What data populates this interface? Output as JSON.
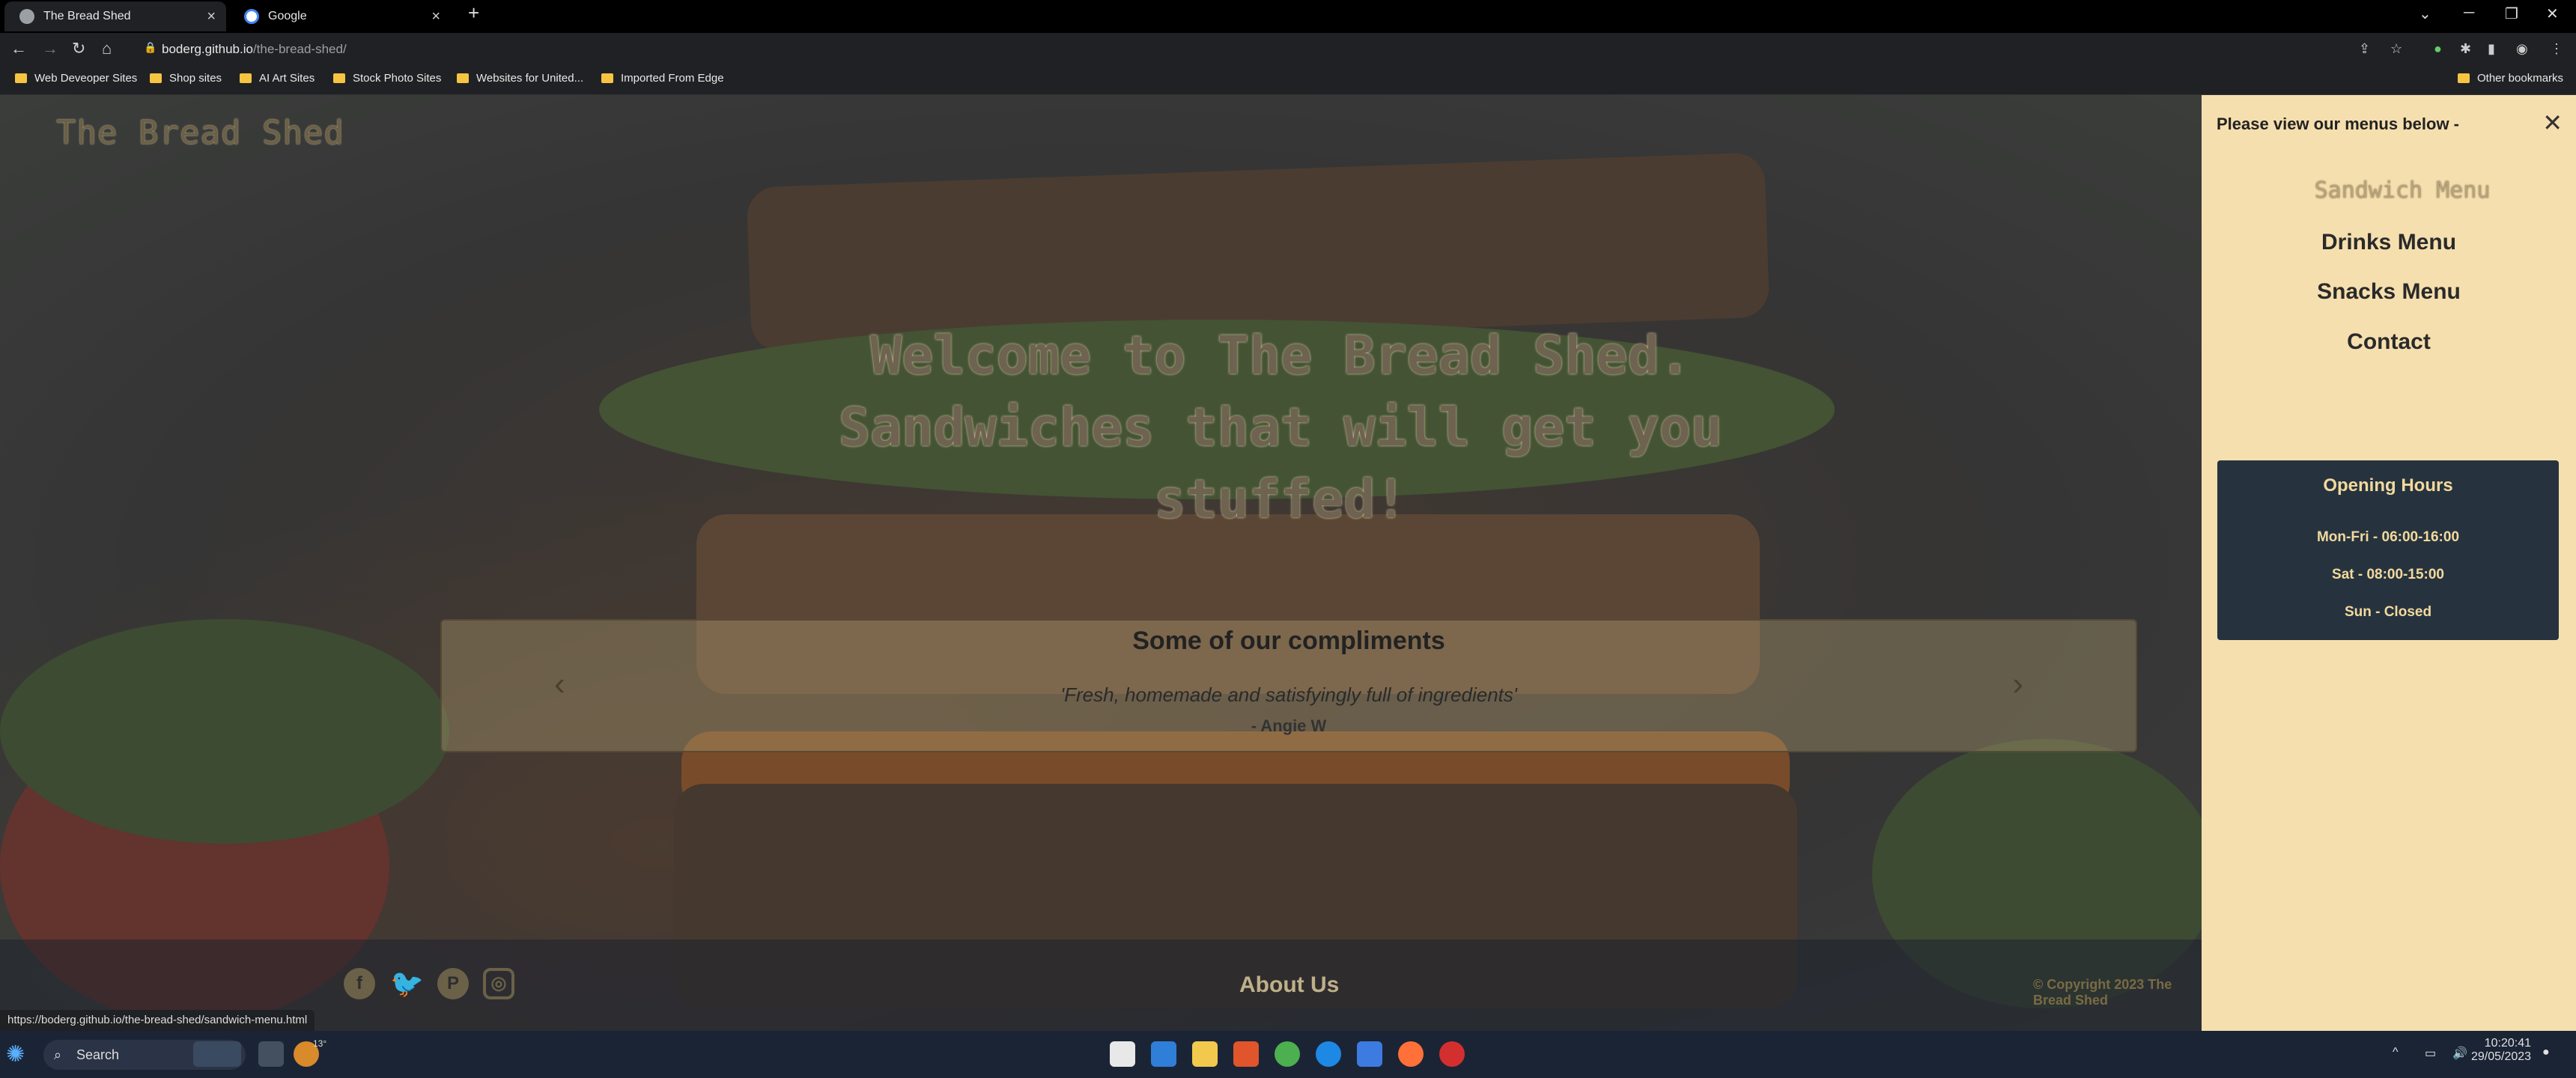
{
  "browser": {
    "tabs": [
      {
        "title": "The Bread Shed",
        "active": true
      },
      {
        "title": "Google",
        "active": false
      }
    ],
    "new_tab": "+",
    "url_host": "boderg.github.io",
    "url_path": "/the-bread-shed/",
    "bookmarks": [
      "Web Deveoper Sites",
      "Shop sites",
      "AI Art Sites",
      "Stock Photo Sites",
      "Websites for United...",
      "Imported From Edge"
    ],
    "other_bookmarks": "Other bookmarks",
    "status_url": "https://boderg.github.io/the-bread-shed/sandwich-menu.html"
  },
  "site": {
    "logo": "The Bread Shed",
    "welcome_line1": "Welcome to The Bread Shed.",
    "welcome_line2": "Sandwiches that will get you stuffed!",
    "compliments": {
      "title": "Some of our compliments",
      "quote": "'Fresh, homemade and satisfyingly full of ingredients'",
      "author": "- Angie W"
    },
    "footer": {
      "about": "About Us",
      "copyright": "© Copyright 2023 The Bread Shed",
      "social": [
        "facebook-icon",
        "twitter-icon",
        "pinterest-icon",
        "instagram-icon"
      ]
    }
  },
  "side_menu": {
    "heading": "Please view our menus below -",
    "items": [
      "Sandwich Menu",
      "Drinks Menu",
      "Snacks Menu",
      "Contact"
    ],
    "opening_hours": {
      "title": "Opening Hours",
      "lines": [
        "Mon-Fri - 06:00-16:00",
        "Sat - 08:00-15:00",
        "Sun - Closed"
      ]
    }
  },
  "taskbar": {
    "search": "Search",
    "weather": "13°",
    "time": "10:20:41",
    "date": "29/05/2023"
  },
  "colors": {
    "side_menu_bg": "#f6dfae",
    "hours_bg": "#26333f",
    "hours_text": "#f3d99c"
  }
}
